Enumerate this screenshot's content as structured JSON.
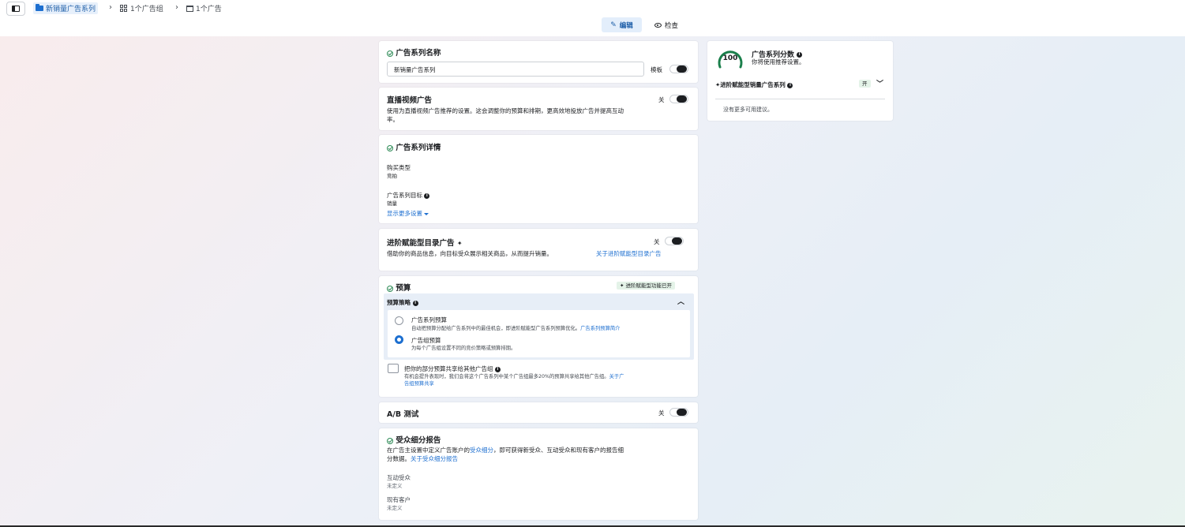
{
  "breadcrumb": {
    "campaign": "新销量广告系列",
    "adsets": "1个广告组",
    "ads": "1个广告"
  },
  "modes": {
    "edit": "编辑",
    "review": "检查"
  },
  "campaign_name": {
    "title": "广告系列名称",
    "value": "新销量广告系列",
    "template_label": "模板"
  },
  "live_video": {
    "title": "直播视频广告",
    "toggle_label": "关",
    "description_1": "使用为直播视频广告推荐的设置。这会调整你的预算和排期，更高效地投放广告并提高互动",
    "description_2": "率。"
  },
  "campaign_details": {
    "title": "广告系列详情",
    "buy_type_label": "购买类型",
    "buy_type_value": "竞拍",
    "objective_label": "广告系列目标",
    "objective_value": "销量",
    "show_more": "显示更多设置"
  },
  "advantage_catalog": {
    "title": "进阶赋能型目录广告",
    "sparkle": "✦",
    "toggle_label": "关",
    "description": "借助你的商品信息，向目标受众展示相关商品，从而提升销量。",
    "link": "关于进阶赋能型目录广告"
  },
  "budget": {
    "title": "预算",
    "badge": "进阶赋能型功能已开",
    "strategy_label": "预算策略",
    "option1_title": "广告系列预算",
    "option1_desc": "自动把预算分配给广告系列中的最佳机会，即进阶赋能型广告系列预算优化。",
    "option1_link": "广告系列预算简介",
    "option2_title": "广告组预算",
    "option2_desc": "为每个广告组设置不同的竞价策略或预算排期。",
    "share_title": "把你的部分预算共享给其他广告组",
    "share_desc": "有机会提升表现时，我们会将这个广告系列中某个广告组最多20%的预算共享给其他广告组。",
    "share_link_1": "关于广",
    "share_link_2": "告组预算共享"
  },
  "ab_test": {
    "title": "A/B 测试",
    "toggle_label": "关"
  },
  "audience": {
    "title": "受众细分报告",
    "desc_1a": "在广告主设置中定义广告账户的",
    "desc_1_link": "受众细分",
    "desc_1b": "，即可获得新受众、互动受众和现有客户的报告细",
    "desc_2": "分数据。",
    "desc_2_link": "关于受众细分报告",
    "engaged_label": "互动受众",
    "engaged_value": "未定义",
    "existing_label": "现有客户",
    "existing_value": "未定义"
  },
  "score": {
    "value": "100",
    "title": "广告系列分数",
    "subtitle": "你将使用推荐设置。",
    "adv_label": "进阶赋能型销量广告系列",
    "adv_status": "开",
    "no_more": "没有更多可用建议。"
  },
  "colors": {
    "accent": "#1d6fd0",
    "success": "#2e8b57",
    "score_ring": "#1a7f4b"
  }
}
